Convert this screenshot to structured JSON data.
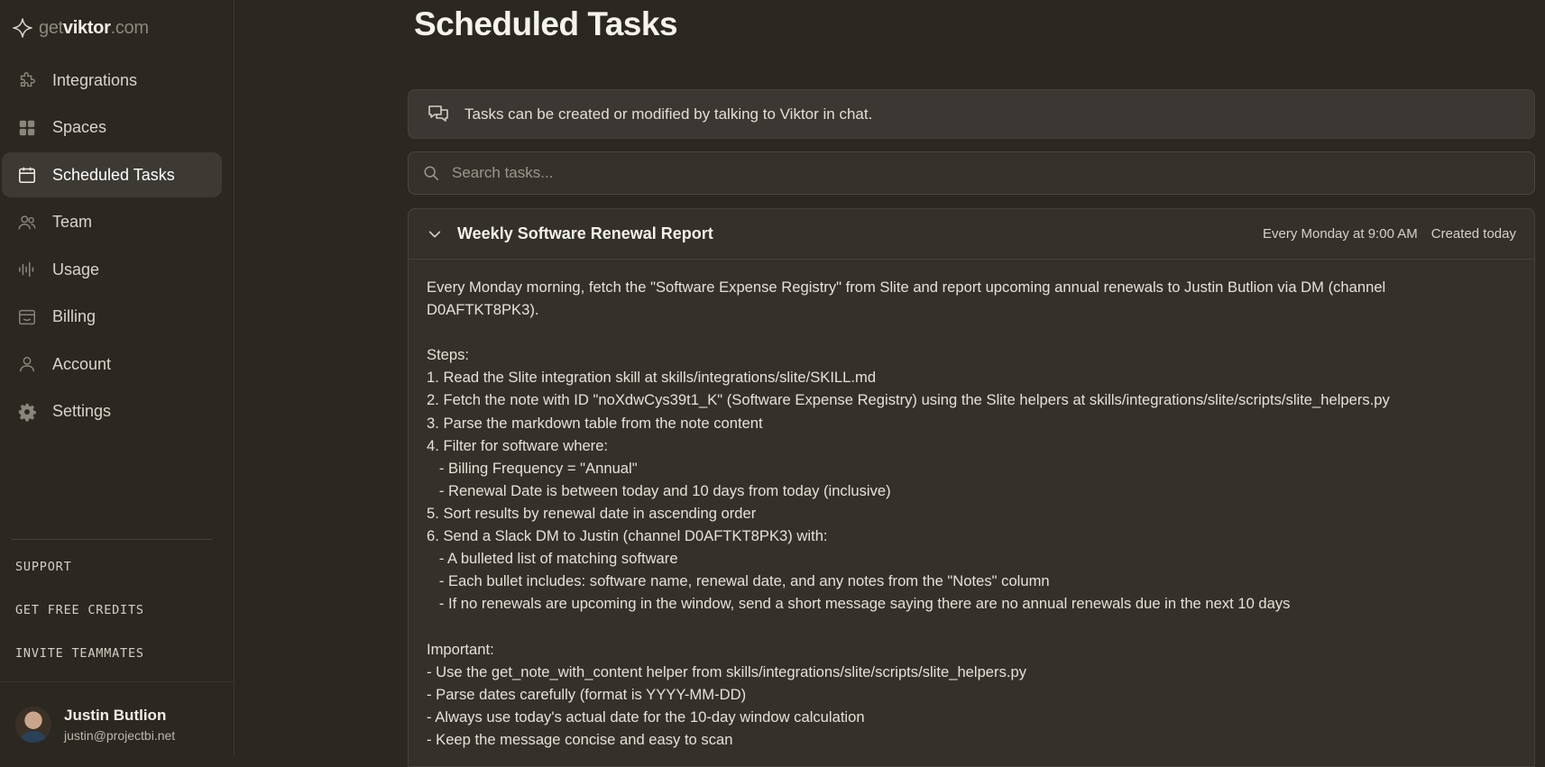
{
  "brand": {
    "prefix": "get",
    "name": "viktor",
    "suffix": ".com"
  },
  "sidebar": {
    "items": [
      {
        "label": "Integrations",
        "icon": "puzzle-icon"
      },
      {
        "label": "Spaces",
        "icon": "grid-icon"
      },
      {
        "label": "Scheduled Tasks",
        "icon": "calendar-icon",
        "active": true
      },
      {
        "label": "Team",
        "icon": "users-icon"
      },
      {
        "label": "Usage",
        "icon": "audio-bars-icon"
      },
      {
        "label": "Billing",
        "icon": "billing-icon"
      },
      {
        "label": "Account",
        "icon": "user-icon"
      },
      {
        "label": "Settings",
        "icon": "gear-icon"
      }
    ],
    "links": [
      "SUPPORT",
      "GET FREE CREDITS",
      "INVITE TEAMMATES"
    ],
    "user": {
      "name": "Justin Butlion",
      "email": "justin@projectbi.net"
    }
  },
  "main": {
    "title": "Scheduled Tasks",
    "info": "Tasks can be created or modified by talking to Viktor in chat.",
    "search_placeholder": "Search tasks...",
    "task": {
      "title": "Weekly Software Renewal Report",
      "schedule": "Every Monday at 9:00 AM",
      "created": "Created today",
      "body": [
        "Every Monday morning, fetch the \"Software Expense Registry\" from Slite and report upcoming annual renewals to Justin Butlion via DM (channel",
        "D0AFTKT8PK3).",
        "",
        "Steps:",
        "1. Read the Slite integration skill at skills/integrations/slite/SKILL.md",
        "2. Fetch the note with ID \"noXdwCys39t1_K\" (Software Expense Registry) using the Slite helpers at skills/integrations/slite/scripts/slite_helpers.py",
        "3. Parse the markdown table from the note content",
        "4. Filter for software where:",
        "   - Billing Frequency = \"Annual\"",
        "   - Renewal Date is between today and 10 days from today (inclusive)",
        "5. Sort results by renewal date in ascending order",
        "6. Send a Slack DM to Justin (channel D0AFTKT8PK3) with:",
        "   - A bulleted list of matching software",
        "   - Each bullet includes: software name, renewal date, and any notes from the \"Notes\" column",
        "   - If no renewals are upcoming in the window, send a short message saying there are no annual renewals due in the next 10 days",
        "",
        "Important:",
        "- Use the get_note_with_content helper from skills/integrations/slite/scripts/slite_helpers.py",
        "- Parse dates carefully (format is YYYY-MM-DD)",
        "- Always use today's actual date for the 10-day window calculation",
        "- Keep the message concise and easy to scan"
      ]
    }
  },
  "colors": {
    "background": "#2b2822",
    "active_item": "#3d3933",
    "card": "#34312b"
  }
}
